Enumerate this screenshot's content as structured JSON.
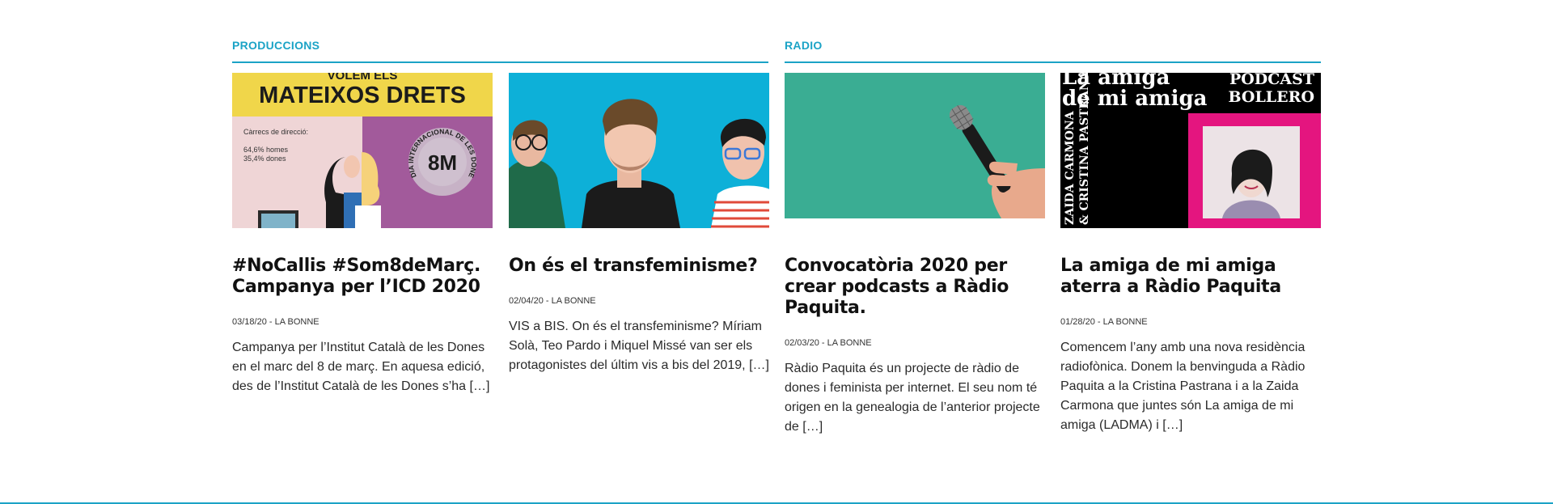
{
  "sections": {
    "produccions": {
      "title": "PRODUCCIONS"
    },
    "radio": {
      "title": "RADIO"
    }
  },
  "colors": {
    "accent": "#1ba3c6"
  },
  "cards": [
    {
      "title": "#NoCallis #Som8deMarç. Campanya per l’ICD 2020",
      "date": "03/18/20",
      "separator": " - ",
      "author": "LA BONNE",
      "excerpt": "Campanya per l’Institut Català de les Dones en el marc del 8 de març. En aquesa edició, des de l’Institut Català de les Dones s’ha",
      "more": "[…]",
      "image": {
        "top_small": "VOLEM ELS",
        "headline": "MATEIXOS DRETS",
        "stat_label": "Càrrecs de direcció:",
        "stat_1": "64,6% homes",
        "stat_2": "35,4% dones",
        "badge_big": "8M",
        "badge_ring": "DIA INTERNACIONAL DE LES DONES"
      }
    },
    {
      "title": "On és el transfeminisme?",
      "date": "02/04/20",
      "separator": " - ",
      "author": "LA BONNE",
      "excerpt": "VIS a BIS. On és el transfeminisme? Míriam Solà, Teo Pardo i Miquel Missé van ser els protagonistes del últim vis a bis del 2019,",
      "more": "[…]"
    },
    {
      "title": "Convocatòria 2020 per crear podcasts a Ràdio Paquita.",
      "date": "02/03/20",
      "separator": " - ",
      "author": "LA BONNE",
      "excerpt": "Ràdio Paquita és un projecte de ràdio de dones i feminista per internet. El seu nom té origen en la genealogia de l’anterior projecte de",
      "more": "[…]"
    },
    {
      "title": "La amiga de mi amiga aterra a Ràdio Paquita",
      "date": "01/28/20",
      "separator": " - ",
      "author": "LA BONNE",
      "excerpt": "Comencem l’any amb una nova residència radiofònica. Donem la benvinguda a Ràdio Paquita a la Cristina Pastrana i a la Zaida Carmona que juntes són La amiga de mi amiga (LADMA) i",
      "more": "[…]",
      "image": {
        "line1": "La amiga",
        "line2": "de mi amiga",
        "tag1": "PODCAST",
        "tag2": "BOLLERO",
        "side1": "ZAIDA CARMONA",
        "side2": "& CRISTINA PASTRANA"
      }
    }
  ]
}
